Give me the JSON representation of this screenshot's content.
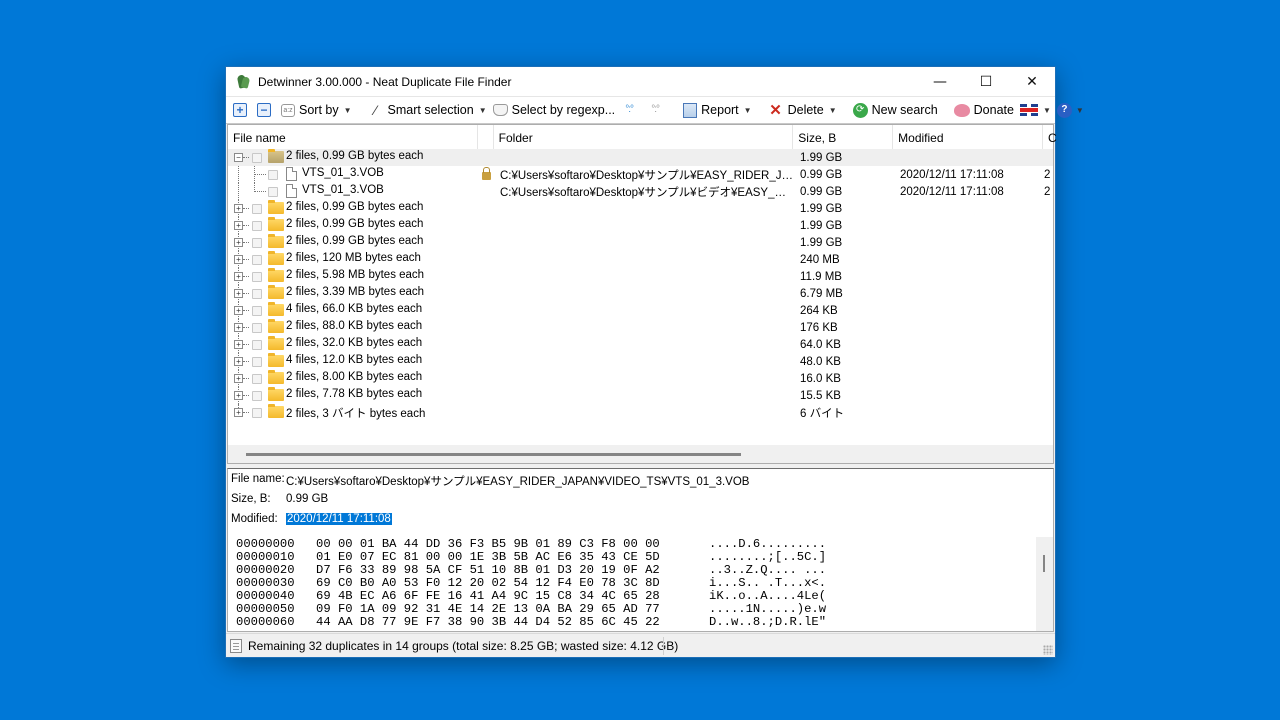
{
  "window": {
    "title": "Detwinner 3.00.000 - Neat Duplicate File Finder",
    "controls": {
      "minimize": "—",
      "maximize": "☐",
      "close": "✕"
    }
  },
  "toolbar": {
    "expand_all_icon": "+",
    "collapse_all_icon": "−",
    "sort_icon": "a:z",
    "sort_label": "Sort by",
    "smart_selection_label": "Smart selection",
    "regex_label": "Select by regexp...",
    "tree_icon_1": "°:°",
    "tree_icon_2": "°:°",
    "report_label": "Report",
    "delete_label": "Delete",
    "new_search_label": "New search",
    "donate_label": "Donate",
    "help_icon": "?",
    "caret": "▼"
  },
  "list": {
    "columns": {
      "file_name": "File name",
      "folder": "Folder",
      "size": "Size, B",
      "modified": "Modified",
      "extra": "C"
    },
    "expanded_group": {
      "label": "2 files, 0.99 GB bytes each",
      "size": "1.99 GB",
      "expander": "−",
      "children": [
        {
          "name": "VTS_01_3.VOB",
          "locked": true,
          "folder": "C:¥Users¥softaro¥Desktop¥サンプル¥EASY_RIDER_JAPA…",
          "size": "0.99 GB",
          "modified": "2020/12/11 17:11:08",
          "extra": "2"
        },
        {
          "name": "VTS_01_3.VOB",
          "locked": false,
          "folder": "C:¥Users¥softaro¥Desktop¥サンプル¥ビデオ¥EASY_RIDER…",
          "size": "0.99 GB",
          "modified": "2020/12/11 17:11:08",
          "extra": "2"
        }
      ]
    },
    "groups": [
      {
        "label": "2 files, 0.99 GB bytes each",
        "size": "1.99 GB"
      },
      {
        "label": "2 files, 0.99 GB bytes each",
        "size": "1.99 GB"
      },
      {
        "label": "2 files, 0.99 GB bytes each",
        "size": "1.99 GB"
      },
      {
        "label": "2 files, 120 MB bytes each",
        "size": "240 MB"
      },
      {
        "label": "2 files, 5.98 MB bytes each",
        "size": "11.9 MB"
      },
      {
        "label": "2 files, 3.39 MB bytes each",
        "size": "6.79 MB"
      },
      {
        "label": "4 files, 66.0 KB bytes each",
        "size": "264 KB"
      },
      {
        "label": "2 files, 88.0 KB bytes each",
        "size": "176 KB"
      },
      {
        "label": "2 files, 32.0 KB bytes each",
        "size": "64.0 KB"
      },
      {
        "label": "4 files, 12.0 KB bytes each",
        "size": "48.0 KB"
      },
      {
        "label": "2 files, 8.00 KB bytes each",
        "size": "16.0 KB"
      },
      {
        "label": "2 files, 7.78 KB bytes each",
        "size": "15.5 KB"
      },
      {
        "label": "2 files, 3 バイト bytes each",
        "size": "6 バイト"
      }
    ],
    "collapsed_expander": "+"
  },
  "details": {
    "file_name_label": "File name:",
    "file_name_value": "C:¥Users¥softaro¥Desktop¥サンプル¥EASY_RIDER_JAPAN¥VIDEO_TS¥VTS_01_3.VOB",
    "size_label": "Size, B:",
    "size_value": "0.99 GB",
    "modified_label": "Modified:",
    "modified_value": "2020/12/11 17:11:08",
    "hex_rows": [
      {
        "offset": "00000000",
        "bytes": "00 00 01 BA 44 DD 36 F3 B5 9B 01 89 C3 F8 00 00",
        "ascii": "....D.6........."
      },
      {
        "offset": "00000010",
        "bytes": "01 E0 07 EC 81 00 00 1E 3B 5B AC E6 35 43 CE 5D",
        "ascii": "........;[..5C.]"
      },
      {
        "offset": "00000020",
        "bytes": "D7 F6 33 89 98 5A CF 51 10 8B 01 D3 20 19 0F A2",
        "ascii": "..3..Z.Q.... ..."
      },
      {
        "offset": "00000030",
        "bytes": "69 C0 B0 A0 53 F0 12 20 02 54 12 F4 E0 78 3C 8D",
        "ascii": "i...S.. .T...x<."
      },
      {
        "offset": "00000040",
        "bytes": "69 4B EC A6 6F FE 16 41 A4 9C 15 C8 34 4C 65 28",
        "ascii": "iK..o..A....4Le("
      },
      {
        "offset": "00000050",
        "bytes": "09 F0 1A 09 92 31 4E 14 2E 13 0A BA 29 65 AD 77",
        "ascii": ".....1N.....)e.w"
      },
      {
        "offset": "00000060",
        "bytes": "44 AA D8 77 9E F7 38 90 3B 44 D4 52 85 6C 45 22",
        "ascii": "D..w..8.;D.R.lE\""
      }
    ]
  },
  "status": {
    "text": "Remaining 32 duplicates in 14 groups (total size: 8.25 GB; wasted size: 4.12 GB)"
  },
  "colors": {
    "desktop": "#0078d7",
    "selection": "#0078d7",
    "folder": "#f4b92c"
  }
}
